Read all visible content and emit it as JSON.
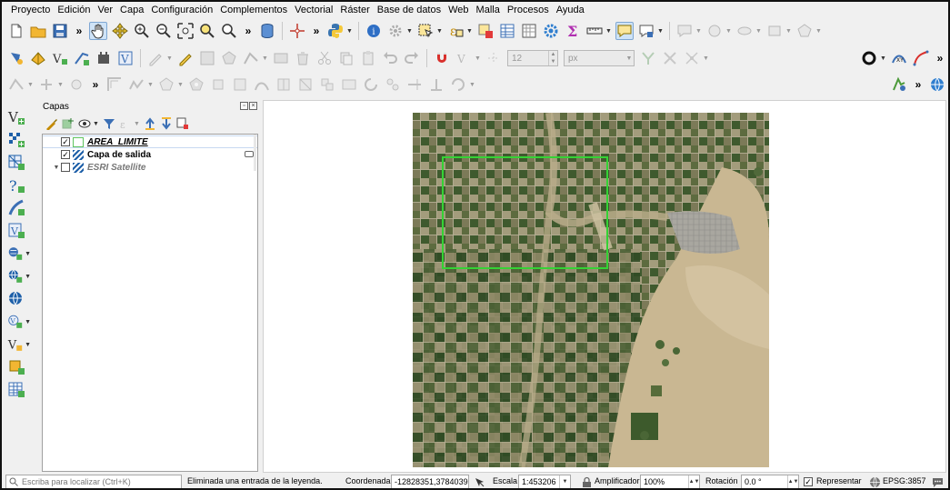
{
  "menubar": {
    "items": [
      "Proyecto",
      "Edición",
      "Ver",
      "Capa",
      "Configuración",
      "Complementos",
      "Vectorial",
      "Ráster",
      "Base de datos",
      "Web",
      "Malla",
      "Procesos",
      "Ayuda"
    ]
  },
  "toolbar": {
    "more": "»",
    "font_size_value": "12",
    "font_unit": "px"
  },
  "layers_panel": {
    "title": "Capas",
    "layers": [
      {
        "name": "AREA_LIMITE",
        "checked": "✓",
        "symbol": "polygon-outline-green"
      },
      {
        "name": "Capa de salida",
        "checked": "✓",
        "symbol": "raster"
      },
      {
        "name": "ESRI Satellite",
        "checked": "",
        "symbol": "raster"
      }
    ]
  },
  "colors": {
    "aoi_outline": "#35d235",
    "accent_blue": "#1d5fa8"
  },
  "statusbar": {
    "locator_placeholder": "Escriba para localizar (Ctrl+K)",
    "message": "Eliminada una entrada de la leyenda.",
    "coord_label": "Coordenada",
    "coord_value": "-12828351,3784039",
    "scale_label": "Escala",
    "scale_value": "1:453206",
    "magnifier_label": "Amplificador",
    "magnifier_value": "100%",
    "rotation_label": "Rotación",
    "rotation_value": "0.0 °",
    "render_label": "Representar",
    "render_checked": "✓",
    "crs": "EPSG:3857"
  }
}
